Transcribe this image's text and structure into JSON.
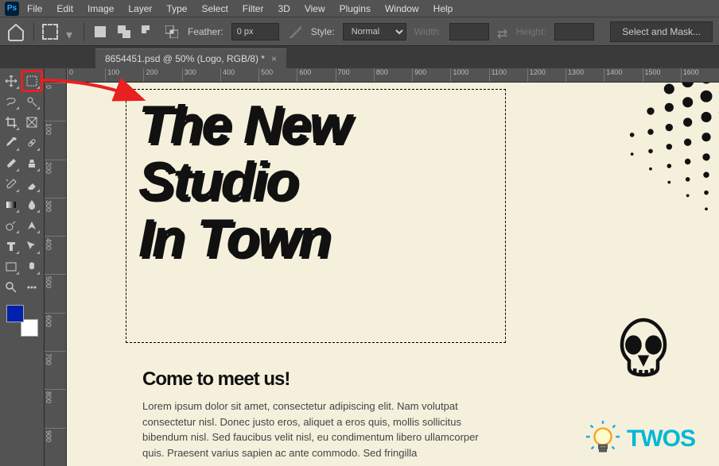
{
  "menubar": {
    "items": [
      "File",
      "Edit",
      "Image",
      "Layer",
      "Type",
      "Select",
      "Filter",
      "3D",
      "View",
      "Plugins",
      "Window",
      "Help"
    ]
  },
  "optionsbar": {
    "feather_label": "Feather:",
    "feather_value": "0 px",
    "style_label": "Style:",
    "style_value": "Normal",
    "width_label": "Width:",
    "height_label": "Height:",
    "select_mask_label": "Select and Mask..."
  },
  "document": {
    "tab_title": "8654451.psd @ 50% (Logo, RGB/8) *"
  },
  "rulers": {
    "horizontal": [
      "0",
      "100",
      "200",
      "300",
      "400",
      "500",
      "600",
      "700",
      "800",
      "900",
      "1000",
      "1100",
      "1200",
      "1300",
      "1400",
      "1500",
      "1600"
    ],
    "vertical": [
      "0",
      "100",
      "200",
      "300",
      "400",
      "500",
      "600",
      "700",
      "800",
      "900"
    ]
  },
  "canvas": {
    "headline_line1": "The New",
    "headline_line2": "Studio",
    "headline_line3": "In Town",
    "subhead": "Come to meet us!",
    "body": "Lorem ipsum dolor sit amet, consectetur adipiscing elit. Nam volutpat consectetur nisl. Donec justo eros, aliquet a eros quis, mollis sollicitus bibendum nisl. Sed faucibus velit nisl, eu condimentum libero ullamcorper quis. Praesent varius sapien ac ante commodo. Sed fringilla"
  },
  "colors": {
    "foreground": "#0020b0",
    "background": "#ffffff",
    "ui_bg": "#535353",
    "canvas_bg": "#f5f0dc",
    "accent_red": "#e82020",
    "twos": "#01b8d7"
  },
  "tools": [
    [
      "move-tool",
      "marquee-tool"
    ],
    [
      "lasso-tool",
      "quick-select-tool"
    ],
    [
      "crop-tool",
      "frame-tool"
    ],
    [
      "eyedropper-tool",
      "healing-tool"
    ],
    [
      "brush-tool",
      "clone-tool"
    ],
    [
      "history-brush-tool",
      "eraser-tool"
    ],
    [
      "gradient-tool",
      "blur-tool"
    ],
    [
      "dodge-tool",
      "pen-tool"
    ],
    [
      "type-tool",
      "path-tool"
    ],
    [
      "rectangle-tool",
      "hand-tool"
    ],
    [
      "zoom-tool",
      "edit-toolbar"
    ]
  ],
  "watermark": {
    "text": "TWOS"
  }
}
